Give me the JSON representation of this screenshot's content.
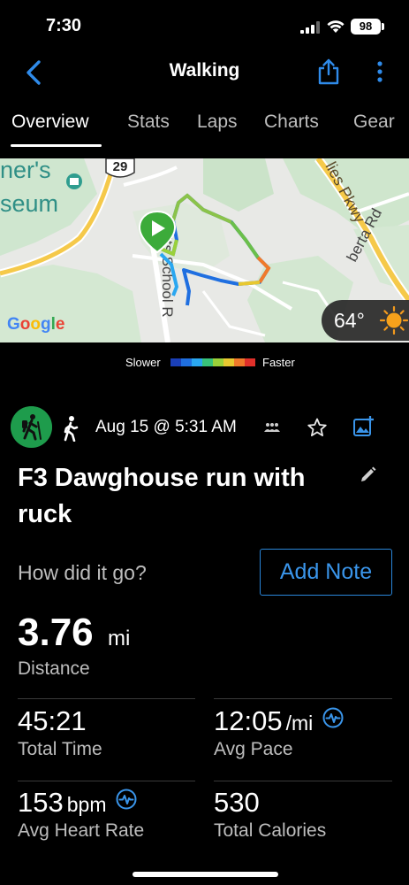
{
  "status_bar": {
    "time": "7:30",
    "battery": "98"
  },
  "nav": {
    "title": "Walking"
  },
  "tabs": [
    {
      "label": "Overview",
      "active": true
    },
    {
      "label": "Stats"
    },
    {
      "label": "Laps"
    },
    {
      "label": "Charts"
    },
    {
      "label": "Gear"
    }
  ],
  "map": {
    "labels": {
      "museum_line1": "ner's",
      "museum_line2": "seum",
      "route_number": "29",
      "school_road": "tts School R",
      "parkway": "lies Pkwy",
      "roberta_road": "berta Rd"
    },
    "attribution": "Google",
    "weather": {
      "temperature": "64°",
      "icon": "sun-icon"
    }
  },
  "legend": {
    "slower": "Slower",
    "faster": "Faster",
    "colors": [
      "#1a3fb8",
      "#1f6fe0",
      "#2aa7f0",
      "#38c27a",
      "#9ad13a",
      "#e8c830",
      "#f07a2a",
      "#e0302a"
    ]
  },
  "activity": {
    "icon": "hiking-icon",
    "type_icon": "walking-icon",
    "date": "Aug 15 @ 5:31 AM",
    "title": "F3 Dawghouse run with ruck",
    "how_label": "How did it go?",
    "add_note": "Add Note"
  },
  "stats": {
    "distance": {
      "value": "3.76",
      "unit": "mi",
      "label": "Distance"
    },
    "total_time": {
      "value": "45:21",
      "label": "Total Time"
    },
    "avg_pace": {
      "value": "12:05",
      "unit": "/mi",
      "label": "Avg Pace"
    },
    "avg_hr": {
      "value": "153",
      "unit": "bpm",
      "label": "Avg Heart Rate"
    },
    "calories": {
      "value": "530",
      "label": "Total Calories"
    }
  },
  "colors": {
    "accent": "#3a95ea",
    "route_green": "#8bc34a",
    "start_marker": "#3cab3a"
  }
}
